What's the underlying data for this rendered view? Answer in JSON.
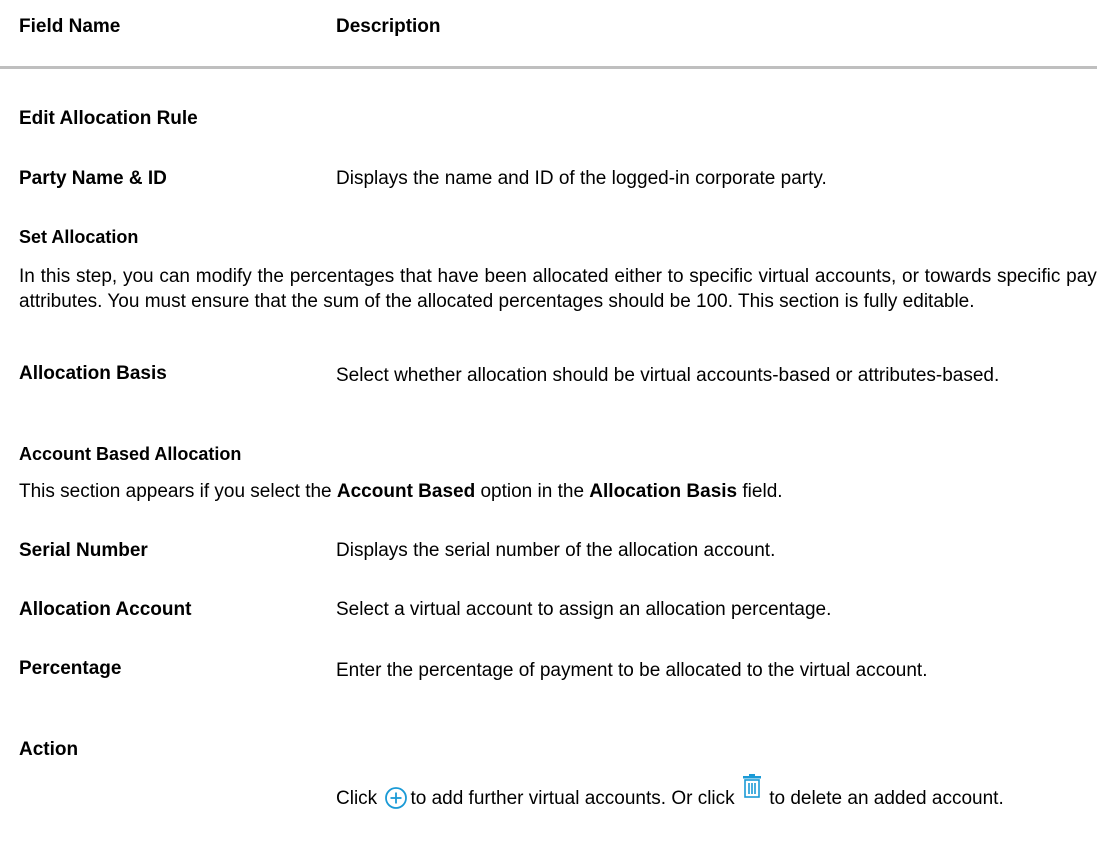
{
  "header": {
    "field_name": "Field Name",
    "description": "Description"
  },
  "sections": {
    "edit_rule": "Edit Allocation Rule",
    "set_allocation": "Set Allocation",
    "set_allocation_text": "In this step, you can modify the percentages that have been allocated either to specific virtual accounts, or towards specific payment attributes. You must ensure that the sum of the allocated percentages should be 100. This section is fully editable.",
    "account_based": "Account Based Allocation",
    "account_based_text_1": "This section appears if you select the ",
    "account_based_bold_1": "Account Based",
    "account_based_text_2": " option in the ",
    "account_based_bold_2": "Allocation Basis",
    "account_based_text_3": " field."
  },
  "rows": {
    "party_name": {
      "field": "Party Name & ID",
      "desc": "Displays the name and ID of the logged-in corporate party."
    },
    "allocation_basis": {
      "field": "Allocation Basis",
      "desc": "Select whether allocation should be virtual accounts-based or attributes-based."
    },
    "serial_number": {
      "field": "Serial Number",
      "desc": "Displays the serial number of the allocation account."
    },
    "allocation_account": {
      "field": "Allocation Account",
      "desc": "Select a virtual account to assign an allocation percentage."
    },
    "percentage": {
      "field": "Percentage",
      "desc": "Enter the percentage of payment to be allocated to the virtual account."
    },
    "action": {
      "field": "Action",
      "desc_1": "Click ",
      "desc_2": "to add further virtual accounts. Or click ",
      "desc_3": " to delete an added account."
    }
  },
  "icons": {
    "add": "add-circle-icon",
    "delete": "trash-icon",
    "icon_color": "#1a9ad6"
  }
}
